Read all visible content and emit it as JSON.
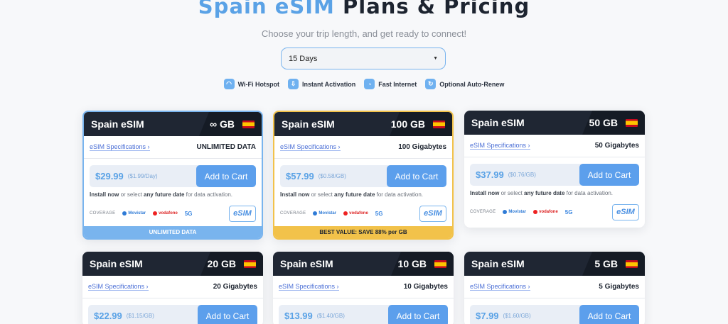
{
  "header": {
    "title_highlight": "Spain eSIM",
    "title_rest": "Plans & Pricing",
    "subtitle": "Choose your trip length, and get ready to connect!"
  },
  "duration_select": {
    "value": "15 Days"
  },
  "features": [
    {
      "label": "Wi-Fi Hotspot",
      "icon": "wifi-icon"
    },
    {
      "label": "Instant Activation",
      "icon": "download-icon"
    },
    {
      "label": "Fast Internet",
      "icon": "speed-icon"
    },
    {
      "label": "Optional Auto-Renew",
      "icon": "refresh-icon"
    }
  ],
  "cards": [
    {
      "name": "Spain eSIM",
      "gb": "∞ GB",
      "spec_link": "eSIM Specifications ›",
      "spec_value": "UNLIMITED DATA",
      "price": "$29.99",
      "unit": "($1.99/Day)",
      "button": "Add to Cart",
      "footer": "UNLIMITED DATA",
      "footer_style": "blue"
    },
    {
      "name": "Spain eSIM",
      "gb": "100 GB",
      "spec_link": "eSIM Specifications ›",
      "spec_value": "100 Gigabytes",
      "price": "$57.99",
      "unit": "($0.58/GB)",
      "button": "Add to Cart",
      "footer": "BEST VALUE: SAVE 88% per GB",
      "footer_style": "gold"
    },
    {
      "name": "Spain eSIM",
      "gb": "50 GB",
      "spec_link": "eSIM Specifications ›",
      "spec_value": "50 Gigabytes",
      "price": "$37.99",
      "unit": "($0.76/GB)",
      "button": "Add to Cart"
    },
    {
      "name": "Spain eSIM",
      "gb": "20 GB",
      "spec_link": "eSIM Specifications ›",
      "spec_value": "20 Gigabytes",
      "price": "$22.99",
      "unit": "($1.15/GB)",
      "button": "Add to Cart"
    },
    {
      "name": "Spain eSIM",
      "gb": "10 GB",
      "spec_link": "eSIM Specifications ›",
      "spec_value": "10 Gigabytes",
      "price": "$13.99",
      "unit": "($1.40/GB)",
      "button": "Add to Cart"
    },
    {
      "name": "Spain eSIM",
      "gb": "5 GB",
      "spec_link": "eSIM Specifications ›",
      "spec_value": "5 Gigabytes",
      "price": "$7.99",
      "unit": "($1.60/GB)",
      "button": "Add to Cart"
    }
  ],
  "card_common": {
    "install_now": "Install now",
    "install_mid": "or select",
    "install_any": "any future date",
    "install_end": "for data activation.",
    "coverage_label": "COVERAGE",
    "op_movistar": "Movistar",
    "op_vodafone": "vodafone",
    "op_5g": "5G",
    "esim_badge": "eSIM"
  },
  "colors": {
    "accent": "#5aa2e6",
    "header_dark": "#1f2633",
    "gold": "#f2c24a",
    "button": "#5c9fec"
  }
}
